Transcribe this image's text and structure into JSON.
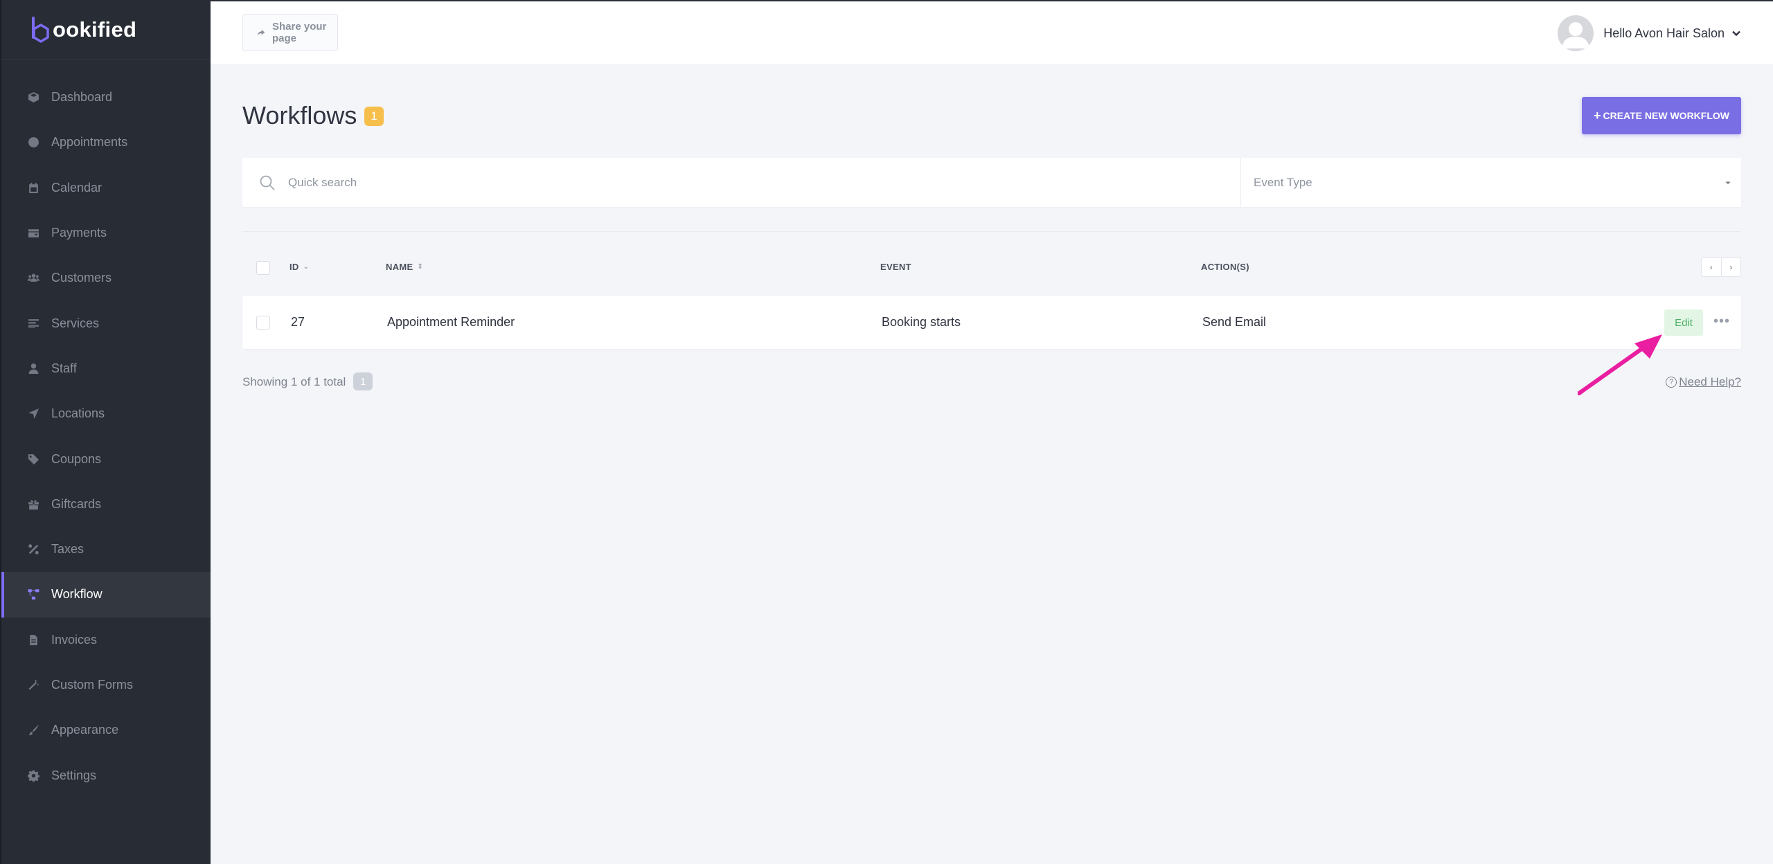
{
  "brand": {
    "logo_text": "ookified",
    "accent": "#7d6cf0"
  },
  "sidebar": {
    "items": [
      {
        "label": "Dashboard",
        "icon": "cube-icon",
        "active": false
      },
      {
        "label": "Appointments",
        "icon": "clock-icon",
        "active": false
      },
      {
        "label": "Calendar",
        "icon": "calendar-icon",
        "active": false
      },
      {
        "label": "Payments",
        "icon": "wallet-icon",
        "active": false
      },
      {
        "label": "Customers",
        "icon": "users-icon",
        "active": false
      },
      {
        "label": "Services",
        "icon": "list-icon",
        "active": false
      },
      {
        "label": "Staff",
        "icon": "user-icon",
        "active": false
      },
      {
        "label": "Locations",
        "icon": "location-arrow-icon",
        "active": false
      },
      {
        "label": "Coupons",
        "icon": "tag-icon",
        "active": false
      },
      {
        "label": "Giftcards",
        "icon": "gift-icon",
        "active": false
      },
      {
        "label": "Taxes",
        "icon": "percent-icon",
        "active": false
      },
      {
        "label": "Workflow",
        "icon": "workflow-icon",
        "active": true
      },
      {
        "label": "Invoices",
        "icon": "file-icon",
        "active": false
      },
      {
        "label": "Custom Forms",
        "icon": "magic-wand-icon",
        "active": false
      },
      {
        "label": "Appearance",
        "icon": "brush-icon",
        "active": false
      },
      {
        "label": "Settings",
        "icon": "gear-icon",
        "active": false
      }
    ]
  },
  "topbar": {
    "share_label": "Share your page",
    "user_greeting": "Hello Avon Hair Salon"
  },
  "page": {
    "title": "Workflows",
    "count": "1",
    "create_label": "CREATE NEW WORKFLOW",
    "create_color": "#7a6ee4"
  },
  "filters": {
    "search_placeholder": "Quick search",
    "search_value": "",
    "event_type_placeholder": "Event Type"
  },
  "table": {
    "columns": {
      "id": "ID",
      "name": "NAME",
      "event": "EVENT",
      "actions": "ACTION(S)"
    },
    "rows": [
      {
        "id": "27",
        "name": "Appointment Reminder",
        "event": "Booking starts",
        "action": "Send Email",
        "edit_label": "Edit"
      }
    ]
  },
  "footer": {
    "showing_text": "Showing 1 of 1 total",
    "page": "1",
    "help_label": "Need Help?"
  },
  "annotation": {
    "arrow_color": "#e91ea0"
  }
}
